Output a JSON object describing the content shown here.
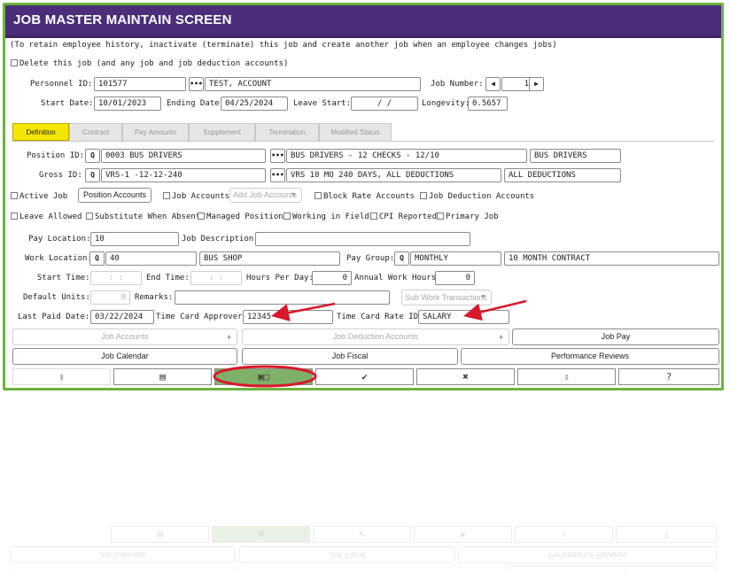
{
  "title": "JOB MASTER MAINTAIN SCREEN",
  "info_note": "(To retain employee history, inactivate (terminate) this job and create another job when an employee changes jobs)",
  "delete_label": "Delete this job (and any job and job deduction accounts)",
  "personnel": {
    "label": "Personnel ID:",
    "id": "101577",
    "name": "TEST, ACCOUNT"
  },
  "job_number": {
    "label": "Job Number:",
    "value": "1"
  },
  "start_date": {
    "label": "Start Date:",
    "value": "10/01/2023"
  },
  "ending_date": {
    "label": "Ending Date:",
    "value": "04/25/2024"
  },
  "leave_start": {
    "label": "Leave Start:",
    "value": "/ /"
  },
  "longevity": {
    "label": "Longevity:",
    "value": "0.5657"
  },
  "tabs": [
    "Definition",
    "Contract",
    "Pay Amounts",
    "Supplement",
    "Termination",
    "Modified Status"
  ],
  "position": {
    "label": "Position ID:",
    "code": "0003 BUS DRIVERS",
    "desc": "BUS DRIVERS - 12 CHECKS - 12/10",
    "short": "BUS DRIVERS"
  },
  "gross": {
    "label": "Gross ID:",
    "code": "VRS-1 -12-12-240",
    "desc": "VRS 10 MO 240 DAYS, ALL DEDUCTIONS",
    "short": "ALL DEDUCTIONS"
  },
  "checks_row1": {
    "active_job": "Active Job",
    "position_accounts": "Position Accounts",
    "job_accounts": "Job Accounts",
    "add_job_accounts": "Add Job Accounts",
    "block_rate": "Block Rate Accounts",
    "job_deduction": "Job Deduction Accounts"
  },
  "checks_row2": {
    "leave_allowed": "Leave Allowed",
    "substitute": "Substitute When Absent",
    "managed": "Managed Position",
    "working_field": "Working in Field",
    "cpi": "CPI Reported",
    "primary": "Primary Job"
  },
  "pay_location": {
    "label": "Pay Location:",
    "value": "10"
  },
  "job_description": {
    "label": "Job Description:",
    "value": ""
  },
  "work_location": {
    "label": "Work Location:",
    "code": "40",
    "desc": "BUS SHOP"
  },
  "pay_group": {
    "label": "Pay Group:",
    "code": "MONTHLY",
    "desc": "10 MONTH CONTRACT"
  },
  "start_time": {
    "label": "Start Time:",
    "value": ": :"
  },
  "end_time": {
    "label": "End Time:",
    "value": ": :"
  },
  "hours_per_day": {
    "label": "Hours Per Day:",
    "value": "0"
  },
  "annual_hours": {
    "label": "Annual Work Hours:",
    "value": "0"
  },
  "default_units": {
    "label": "Default Units:",
    "value": "0"
  },
  "remarks": {
    "label": "Remarks:",
    "value": ""
  },
  "sub_work": "Sub Work Transactions",
  "last_paid": {
    "label": "Last Paid Date:",
    "value": "03/22/2024"
  },
  "approver": {
    "label": "Time Card Approver:",
    "value": "12345"
  },
  "rate_id": {
    "label": "Time Card Rate ID:",
    "value": "SALARY"
  },
  "buttons": {
    "job_accounts": "Job Accounts",
    "job_deduction_accounts": "Job Deduction Accounts",
    "job_pay": "Job Pay",
    "job_calendar": "Job Calendar",
    "job_fiscal": "Job Fiscal",
    "performance_reviews": "Performance Reviews"
  },
  "colors": {
    "header": "#4b2d7a",
    "frame": "#6db33f",
    "active_tab": "#f5e600",
    "highlight": "#d9182b",
    "highlight_fill": "#7fb069"
  }
}
